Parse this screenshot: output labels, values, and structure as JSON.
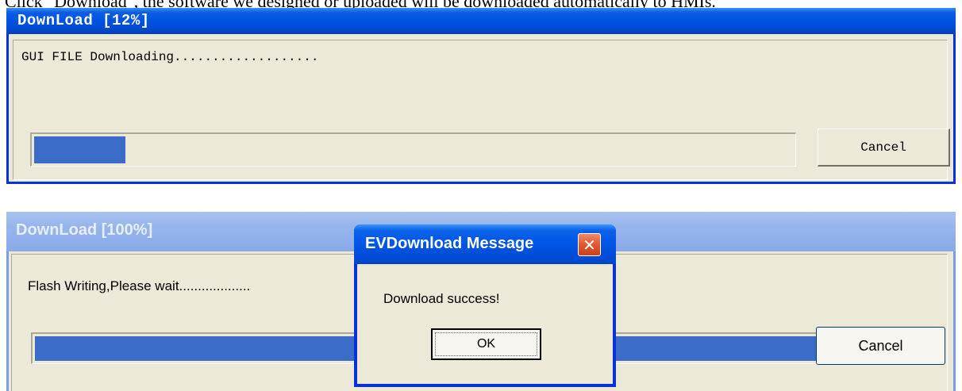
{
  "doc_text": "Click \"Download\", the software we designed or uploaded will be downloaded automatically to HMIs.",
  "window1": {
    "title": "DownLoad [12%]",
    "message": "GUI FILE Downloading...................",
    "progress": 0.12,
    "cancel_label": "Cancel"
  },
  "window2": {
    "title": "DownLoad [100%]",
    "message": "Flash Writing,Please wait...................",
    "progress": 1.0,
    "cancel_label": "Cancel"
  },
  "dialog": {
    "title": "EVDownload Message",
    "close_icon": "close-icon",
    "message": "Download success!",
    "ok_label": "OK"
  },
  "colors": {
    "titlebar_active": "#0054e3",
    "titlebar_inactive": "#96b4ec",
    "progress_fill": "#3c6cc8",
    "dialog_bg": "#ece9d8"
  }
}
